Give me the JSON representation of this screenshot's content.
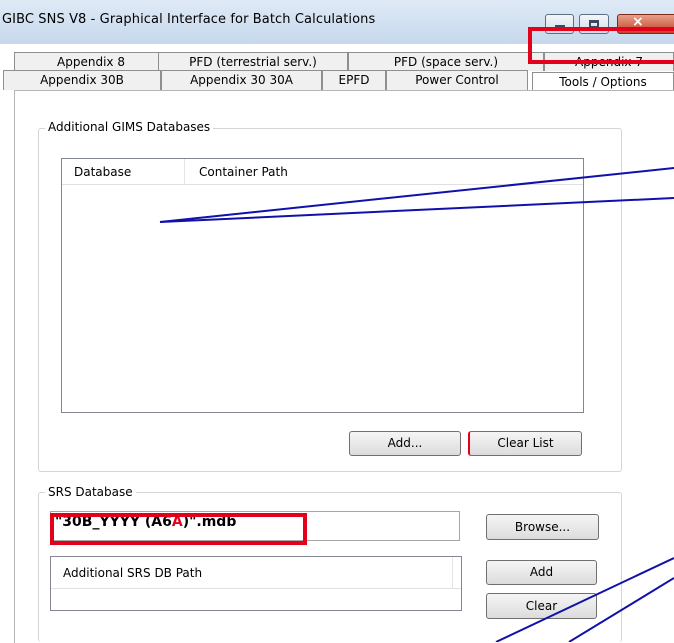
{
  "window": {
    "title": "GIBC SNS V8 - Graphical Interface for Batch Calculations",
    "controls": {
      "minimize": "minimize-icon",
      "maximize": "maximize-icon",
      "close": "close-icon",
      "close_glyph": "×"
    }
  },
  "tabs": {
    "row1": [
      "Appendix 8",
      "PFD (terrestrial serv.)",
      "PFD (space serv.)",
      "Appendix 7"
    ],
    "row2": [
      "Appendix 30B",
      "Appendix 30 30A",
      "EPFD",
      "Power Control",
      "Tools / Options"
    ],
    "active": "Tools / Options"
  },
  "gims": {
    "group_title": "Additional GIMS Databases",
    "columns": [
      "Database",
      "Container Path"
    ],
    "rows": [],
    "add_label": "Add...",
    "clear_label": "Clear List"
  },
  "srs": {
    "group_title": "SRS Database",
    "value_prefix": "\"30B_YYYY (A6",
    "value_highlight": "A",
    "value_suffix": ")\".mdb",
    "browse_label": "Browse...",
    "additional_header": "Additional SRS DB Path",
    "add_label": "Add",
    "clear_label": "Clear"
  },
  "colors": {
    "highlight": "#e3001b",
    "titlebar": "#c6d8ec"
  }
}
